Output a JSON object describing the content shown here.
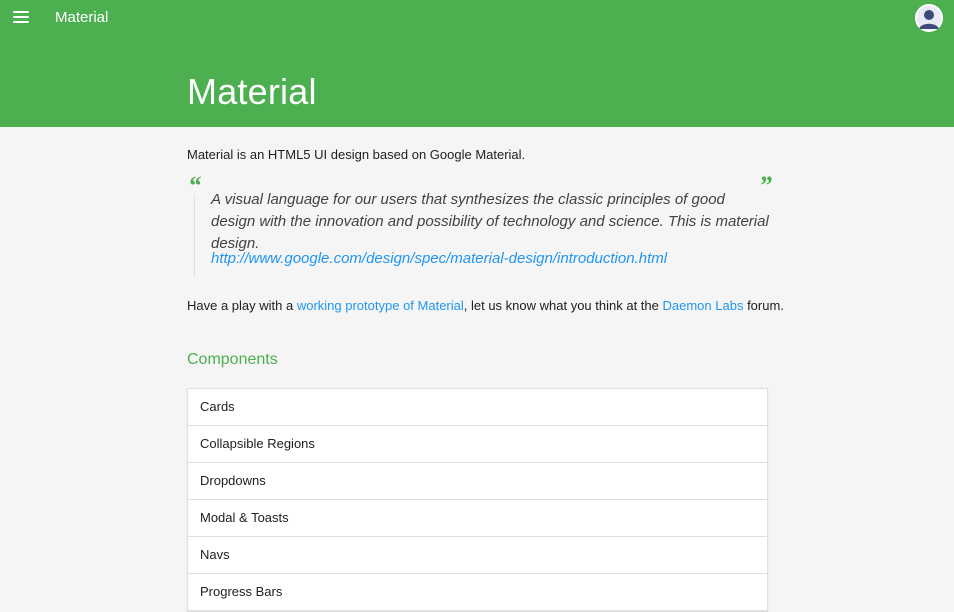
{
  "header": {
    "app_title": "Material",
    "page_title": "Material",
    "menu_icon": "menu-icon",
    "avatar_icon": "user-avatar-icon",
    "accent_color": "#4caf50"
  },
  "intro": "Material is an HTML5 UI design based on Google Material.",
  "quote": {
    "open_mark": "“",
    "close_mark": "”",
    "text": "A visual language for our users that synthesizes the classic principles of good design with the innovation and possibility of technology and science. This is material design.",
    "link": "http://www.google.com/design/spec/material-design/introduction.html"
  },
  "play": {
    "prefix": "Have a play with a ",
    "link1": "working prototype of Material",
    "middle": ", let us know what you think at the ",
    "link2": "Daemon Labs",
    "suffix": " forum.",
    "link_color": "#2196f3"
  },
  "components": {
    "title": "Components",
    "items": [
      {
        "label": "Cards"
      },
      {
        "label": "Collapsible Regions"
      },
      {
        "label": "Dropdowns"
      },
      {
        "label": "Modal & Toasts"
      },
      {
        "label": "Navs"
      },
      {
        "label": "Progress Bars"
      }
    ]
  }
}
